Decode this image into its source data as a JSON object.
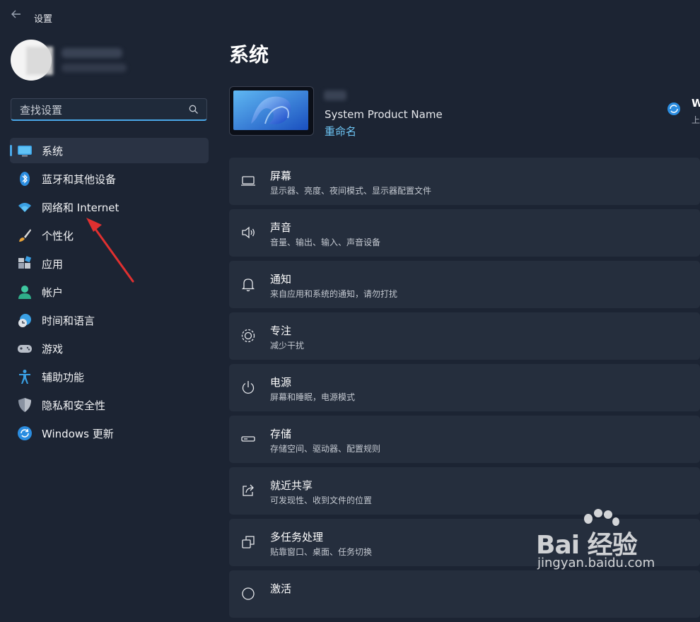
{
  "window": {
    "title": "设置"
  },
  "sidebar": {
    "search_placeholder": "查找设置",
    "items": [
      {
        "label": "系统",
        "icon": "monitor-icon",
        "active": true
      },
      {
        "label": "蓝牙和其他设备",
        "icon": "bluetooth-icon"
      },
      {
        "label": "网络和 Internet",
        "icon": "wifi-icon"
      },
      {
        "label": "个性化",
        "icon": "brush-icon"
      },
      {
        "label": "应用",
        "icon": "apps-icon"
      },
      {
        "label": "帐户",
        "icon": "account-icon"
      },
      {
        "label": "时间和语言",
        "icon": "globe-clock-icon"
      },
      {
        "label": "游戏",
        "icon": "gamepad-icon"
      },
      {
        "label": "辅助功能",
        "icon": "accessibility-icon"
      },
      {
        "label": "隐私和安全性",
        "icon": "shield-icon"
      },
      {
        "label": "Windows 更新",
        "icon": "update-icon"
      }
    ]
  },
  "main": {
    "title": "系统",
    "device": {
      "model": "System Product Name",
      "rename": "重命名"
    },
    "update": {
      "title": "W",
      "subtitle": "上"
    },
    "cards": [
      {
        "title": "屏幕",
        "subtitle": "显示器、亮度、夜间模式、显示器配置文件",
        "icon": "display-icon"
      },
      {
        "title": "声音",
        "subtitle": "音量、输出、输入、声音设备",
        "icon": "speaker-icon"
      },
      {
        "title": "通知",
        "subtitle": "来自应用和系统的通知，请勿打扰",
        "icon": "bell-icon"
      },
      {
        "title": "专注",
        "subtitle": "减少干扰",
        "icon": "focus-icon"
      },
      {
        "title": "电源",
        "subtitle": "屏幕和睡眠，电源模式",
        "icon": "power-icon"
      },
      {
        "title": "存储",
        "subtitle": "存储空间、驱动器、配置规则",
        "icon": "storage-icon"
      },
      {
        "title": "就近共享",
        "subtitle": "可发现性、收到文件的位置",
        "icon": "share-icon"
      },
      {
        "title": "多任务处理",
        "subtitle": "贴靠窗口、桌面、任务切换",
        "icon": "multitask-icon"
      },
      {
        "title": "激活",
        "subtitle": "",
        "icon": "activation-icon"
      }
    ]
  },
  "watermark": {
    "brand": "Bai 经验",
    "url": "jingyan.baidu.com"
  },
  "colors": {
    "accent": "#4aa8e8",
    "link": "#6ec6f5",
    "background": "#1c2433",
    "card": "#252e3d",
    "annotation": "#e03030"
  }
}
